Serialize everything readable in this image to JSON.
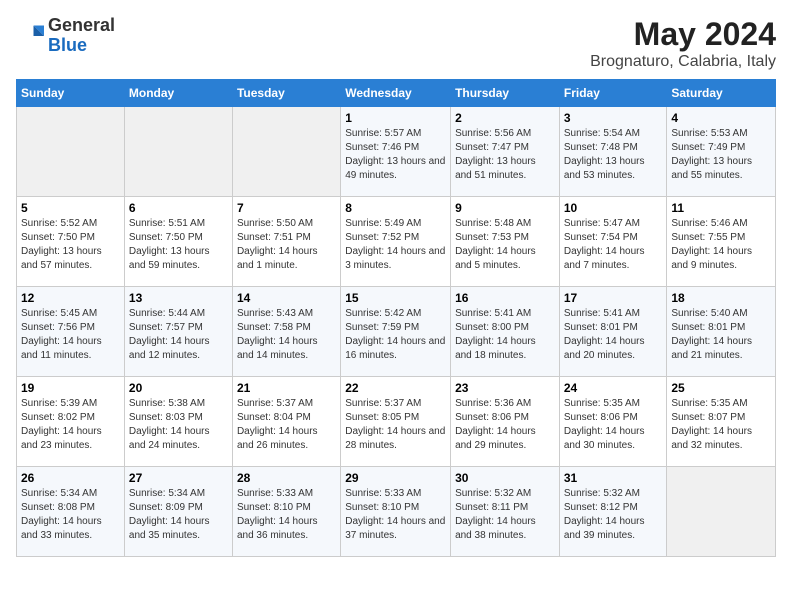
{
  "header": {
    "logo_general": "General",
    "logo_blue": "Blue",
    "month_title": "May 2024",
    "location": "Brognaturo, Calabria, Italy"
  },
  "weekdays": [
    "Sunday",
    "Monday",
    "Tuesday",
    "Wednesday",
    "Thursday",
    "Friday",
    "Saturday"
  ],
  "weeks": [
    [
      {
        "day": "",
        "sunrise": "",
        "sunset": "",
        "daylight": "",
        "empty": true
      },
      {
        "day": "",
        "sunrise": "",
        "sunset": "",
        "daylight": "",
        "empty": true
      },
      {
        "day": "",
        "sunrise": "",
        "sunset": "",
        "daylight": "",
        "empty": true
      },
      {
        "day": "1",
        "sunrise": "Sunrise: 5:57 AM",
        "sunset": "Sunset: 7:46 PM",
        "daylight": "Daylight: 13 hours and 49 minutes."
      },
      {
        "day": "2",
        "sunrise": "Sunrise: 5:56 AM",
        "sunset": "Sunset: 7:47 PM",
        "daylight": "Daylight: 13 hours and 51 minutes."
      },
      {
        "day": "3",
        "sunrise": "Sunrise: 5:54 AM",
        "sunset": "Sunset: 7:48 PM",
        "daylight": "Daylight: 13 hours and 53 minutes."
      },
      {
        "day": "4",
        "sunrise": "Sunrise: 5:53 AM",
        "sunset": "Sunset: 7:49 PM",
        "daylight": "Daylight: 13 hours and 55 minutes."
      }
    ],
    [
      {
        "day": "5",
        "sunrise": "Sunrise: 5:52 AM",
        "sunset": "Sunset: 7:50 PM",
        "daylight": "Daylight: 13 hours and 57 minutes."
      },
      {
        "day": "6",
        "sunrise": "Sunrise: 5:51 AM",
        "sunset": "Sunset: 7:50 PM",
        "daylight": "Daylight: 13 hours and 59 minutes."
      },
      {
        "day": "7",
        "sunrise": "Sunrise: 5:50 AM",
        "sunset": "Sunset: 7:51 PM",
        "daylight": "Daylight: 14 hours and 1 minute."
      },
      {
        "day": "8",
        "sunrise": "Sunrise: 5:49 AM",
        "sunset": "Sunset: 7:52 PM",
        "daylight": "Daylight: 14 hours and 3 minutes."
      },
      {
        "day": "9",
        "sunrise": "Sunrise: 5:48 AM",
        "sunset": "Sunset: 7:53 PM",
        "daylight": "Daylight: 14 hours and 5 minutes."
      },
      {
        "day": "10",
        "sunrise": "Sunrise: 5:47 AM",
        "sunset": "Sunset: 7:54 PM",
        "daylight": "Daylight: 14 hours and 7 minutes."
      },
      {
        "day": "11",
        "sunrise": "Sunrise: 5:46 AM",
        "sunset": "Sunset: 7:55 PM",
        "daylight": "Daylight: 14 hours and 9 minutes."
      }
    ],
    [
      {
        "day": "12",
        "sunrise": "Sunrise: 5:45 AM",
        "sunset": "Sunset: 7:56 PM",
        "daylight": "Daylight: 14 hours and 11 minutes."
      },
      {
        "day": "13",
        "sunrise": "Sunrise: 5:44 AM",
        "sunset": "Sunset: 7:57 PM",
        "daylight": "Daylight: 14 hours and 12 minutes."
      },
      {
        "day": "14",
        "sunrise": "Sunrise: 5:43 AM",
        "sunset": "Sunset: 7:58 PM",
        "daylight": "Daylight: 14 hours and 14 minutes."
      },
      {
        "day": "15",
        "sunrise": "Sunrise: 5:42 AM",
        "sunset": "Sunset: 7:59 PM",
        "daylight": "Daylight: 14 hours and 16 minutes."
      },
      {
        "day": "16",
        "sunrise": "Sunrise: 5:41 AM",
        "sunset": "Sunset: 8:00 PM",
        "daylight": "Daylight: 14 hours and 18 minutes."
      },
      {
        "day": "17",
        "sunrise": "Sunrise: 5:41 AM",
        "sunset": "Sunset: 8:01 PM",
        "daylight": "Daylight: 14 hours and 20 minutes."
      },
      {
        "day": "18",
        "sunrise": "Sunrise: 5:40 AM",
        "sunset": "Sunset: 8:01 PM",
        "daylight": "Daylight: 14 hours and 21 minutes."
      }
    ],
    [
      {
        "day": "19",
        "sunrise": "Sunrise: 5:39 AM",
        "sunset": "Sunset: 8:02 PM",
        "daylight": "Daylight: 14 hours and 23 minutes."
      },
      {
        "day": "20",
        "sunrise": "Sunrise: 5:38 AM",
        "sunset": "Sunset: 8:03 PM",
        "daylight": "Daylight: 14 hours and 24 minutes."
      },
      {
        "day": "21",
        "sunrise": "Sunrise: 5:37 AM",
        "sunset": "Sunset: 8:04 PM",
        "daylight": "Daylight: 14 hours and 26 minutes."
      },
      {
        "day": "22",
        "sunrise": "Sunrise: 5:37 AM",
        "sunset": "Sunset: 8:05 PM",
        "daylight": "Daylight: 14 hours and 28 minutes."
      },
      {
        "day": "23",
        "sunrise": "Sunrise: 5:36 AM",
        "sunset": "Sunset: 8:06 PM",
        "daylight": "Daylight: 14 hours and 29 minutes."
      },
      {
        "day": "24",
        "sunrise": "Sunrise: 5:35 AM",
        "sunset": "Sunset: 8:06 PM",
        "daylight": "Daylight: 14 hours and 30 minutes."
      },
      {
        "day": "25",
        "sunrise": "Sunrise: 5:35 AM",
        "sunset": "Sunset: 8:07 PM",
        "daylight": "Daylight: 14 hours and 32 minutes."
      }
    ],
    [
      {
        "day": "26",
        "sunrise": "Sunrise: 5:34 AM",
        "sunset": "Sunset: 8:08 PM",
        "daylight": "Daylight: 14 hours and 33 minutes."
      },
      {
        "day": "27",
        "sunrise": "Sunrise: 5:34 AM",
        "sunset": "Sunset: 8:09 PM",
        "daylight": "Daylight: 14 hours and 35 minutes."
      },
      {
        "day": "28",
        "sunrise": "Sunrise: 5:33 AM",
        "sunset": "Sunset: 8:10 PM",
        "daylight": "Daylight: 14 hours and 36 minutes."
      },
      {
        "day": "29",
        "sunrise": "Sunrise: 5:33 AM",
        "sunset": "Sunset: 8:10 PM",
        "daylight": "Daylight: 14 hours and 37 minutes."
      },
      {
        "day": "30",
        "sunrise": "Sunrise: 5:32 AM",
        "sunset": "Sunset: 8:11 PM",
        "daylight": "Daylight: 14 hours and 38 minutes."
      },
      {
        "day": "31",
        "sunrise": "Sunrise: 5:32 AM",
        "sunset": "Sunset: 8:12 PM",
        "daylight": "Daylight: 14 hours and 39 minutes."
      },
      {
        "day": "",
        "sunrise": "",
        "sunset": "",
        "daylight": "",
        "empty": true
      }
    ]
  ]
}
